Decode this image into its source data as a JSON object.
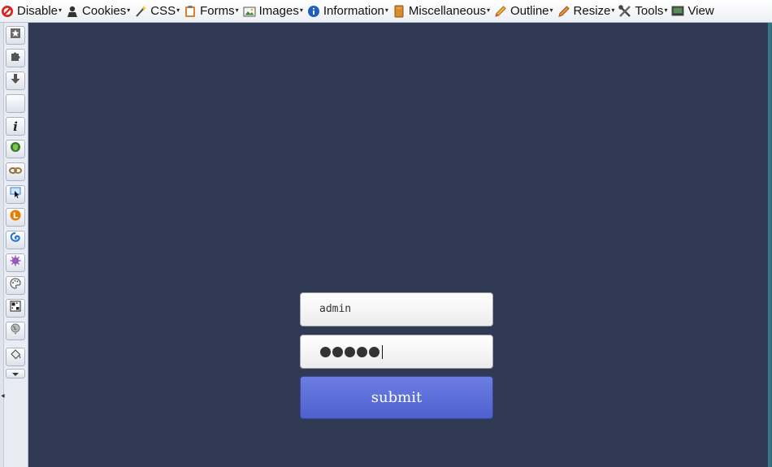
{
  "toolbar": {
    "items": [
      {
        "label": "Disable",
        "icon": "disable-icon"
      },
      {
        "label": "Cookies",
        "icon": "cookies-icon"
      },
      {
        "label": "CSS",
        "icon": "css-wand-icon"
      },
      {
        "label": "Forms",
        "icon": "forms-clipboard-icon"
      },
      {
        "label": "Images",
        "icon": "images-icon"
      },
      {
        "label": "Information",
        "icon": "information-icon"
      },
      {
        "label": "Miscellaneous",
        "icon": "miscellaneous-icon"
      },
      {
        "label": "Outline",
        "icon": "outline-pencil-icon"
      },
      {
        "label": "Resize",
        "icon": "resize-pencil-icon"
      },
      {
        "label": "Tools",
        "icon": "tools-icon"
      },
      {
        "label": "View",
        "icon": "view-monitor-icon"
      }
    ],
    "caret": "▾"
  },
  "sidebar": {
    "buttons": [
      "bookmark-star-icon",
      "addon-puzzle-icon",
      "download-arrow-icon",
      "blank-icon",
      "info-italic-icon",
      "shield-icon",
      "link-chain-icon",
      "pointer-select-icon",
      "orange-l-icon",
      "blue-swirl-icon",
      "purple-burst-icon",
      "palette-icon",
      "qr-grid-icon",
      "globe-icon",
      "paint-bucket-icon",
      "overflow-chevron-icon"
    ]
  },
  "form": {
    "username": "admin",
    "password_mask_count": 5,
    "submit_label": "submit"
  },
  "colors": {
    "page_background": "#313a55",
    "submit_button": "#5a6bd8"
  }
}
